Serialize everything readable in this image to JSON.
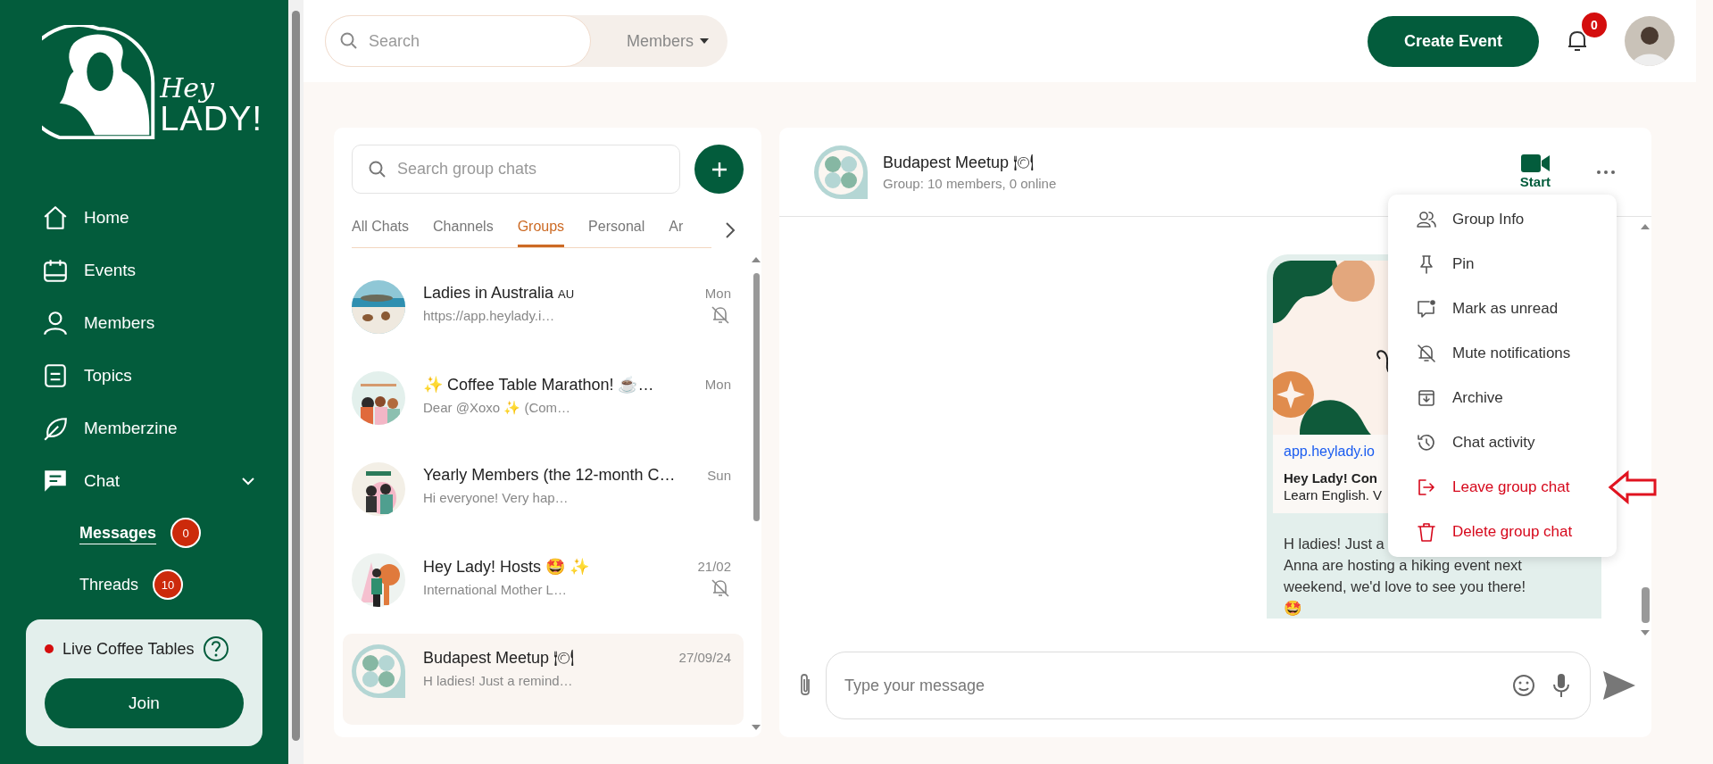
{
  "sidebar": {
    "logo": {
      "line1": "Hey",
      "line2": "LADY!"
    },
    "items": [
      {
        "label": "Home",
        "kind": "home",
        "selected": false
      },
      {
        "label": "Events",
        "kind": "events",
        "selected": false
      },
      {
        "label": "Members",
        "kind": "members",
        "selected": false
      },
      {
        "label": "Topics",
        "kind": "topics",
        "selected": false
      },
      {
        "label": "Memberzine",
        "kind": "memberzine",
        "selected": false
      },
      {
        "label": "Chat",
        "kind": "chat",
        "selected": false,
        "expanded": true,
        "children": [
          {
            "label": "Messages",
            "badge": "0",
            "selected": true
          },
          {
            "label": "Threads",
            "badge": "10",
            "selected": false
          }
        ]
      }
    ],
    "live_card": {
      "label": "Live Coffee Tables",
      "button": "Join"
    }
  },
  "top_bar": {
    "search": {
      "placeholder": "Search"
    },
    "filter": "Members",
    "create_button": "Create Event",
    "notifications": "0"
  },
  "chat_list": {
    "search": {
      "placeholder": "Search group chats"
    },
    "tabs": [
      {
        "label": "All Chats",
        "selected": false
      },
      {
        "label": "Channels",
        "selected": false
      },
      {
        "label": "Groups",
        "selected": true
      },
      {
        "label": "Personal",
        "selected": false
      },
      {
        "label": "Ar",
        "selected": false
      }
    ],
    "chats": [
      {
        "name": "Ladies in Australia",
        "suffix": "AU",
        "preview": "https://app.heylady.i…",
        "time": "Mon",
        "muted": true,
        "selected": false,
        "kind": "picture"
      },
      {
        "name": "✨ Coffee Table Marathon! ☕…",
        "preview": "Dear @Xoxo ✨ (Com…",
        "time": "Mon",
        "muted": false,
        "selected": false,
        "kind": "picture"
      },
      {
        "name": "Yearly Members (the 12-month C…",
        "preview": "Hi everyone! Very hap…",
        "time": "Sun",
        "muted": false,
        "selected": false,
        "kind": "picture"
      },
      {
        "name": "Hey Lady! Hosts 🤩 ✨",
        "preview": "International Mother L…",
        "time": "21/02",
        "muted": true,
        "selected": false,
        "kind": "picture"
      },
      {
        "name": "Budapest Meetup 🍽",
        "preview": "H ladies! Just a remind…",
        "time": "27/09/24",
        "muted": false,
        "selected": true,
        "kind": "group-logo"
      }
    ]
  },
  "chat": {
    "title": "Budapest Meetup 🍽",
    "subtitle": "Group: 10 members, 0 online",
    "video_label": "Start",
    "message": {
      "link": "app.heylady.io",
      "link_title": "Hey Lady! Con",
      "link_desc": "Learn English. V",
      "lines": [
        "H ladies! Just a",
        "Anna are hosting a hiking event next",
        "weekend, we'd love to see you there!",
        "🤩"
      ]
    },
    "composer": {
      "placeholder": "Type your message"
    }
  },
  "menu": {
    "items": [
      {
        "label": "Group Info",
        "kind": "group-info",
        "danger": false,
        "highlighted": false
      },
      {
        "label": "Pin",
        "kind": "pin",
        "danger": false,
        "highlighted": false
      },
      {
        "label": "Mark as unread",
        "kind": "unread",
        "danger": false,
        "highlighted": false
      },
      {
        "label": "Mute notifications",
        "kind": "mute",
        "danger": false,
        "highlighted": false
      },
      {
        "label": "Archive",
        "kind": "archive",
        "danger": false,
        "highlighted": false
      },
      {
        "label": "Chat activity",
        "kind": "history",
        "danger": false,
        "highlighted": false
      },
      {
        "label": "Leave group chat",
        "kind": "leave",
        "danger": true,
        "highlighted": true
      },
      {
        "label": "Delete group chat",
        "kind": "delete",
        "danger": true,
        "highlighted": false
      }
    ]
  }
}
